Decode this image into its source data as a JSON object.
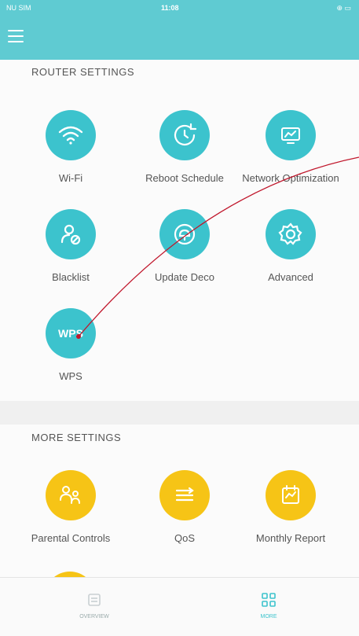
{
  "status_bar": {
    "carrier": "NU SIM",
    "time": "11:08",
    "battery": "⊕ ▭"
  },
  "router_settings": {
    "title": "ROUTER SETTINGS",
    "items": [
      {
        "label": "Wi-Fi",
        "icon": "wifi-icon"
      },
      {
        "label": "Reboot Schedule",
        "icon": "reboot-schedule-icon"
      },
      {
        "label": "Network Optimization",
        "icon": "network-optimization-icon"
      },
      {
        "label": "Blacklist",
        "icon": "blacklist-icon"
      },
      {
        "label": "Update Deco",
        "icon": "update-deco-icon"
      },
      {
        "label": "Advanced",
        "icon": "advanced-gear-icon"
      },
      {
        "label": "WPS",
        "icon": "wps-icon",
        "icon_text": "WPS"
      }
    ]
  },
  "more_settings": {
    "title": "MORE SETTINGS",
    "items": [
      {
        "label": "Parental Controls",
        "icon": "parental-controls-icon"
      },
      {
        "label": "QoS",
        "icon": "qos-icon"
      },
      {
        "label": "Monthly Report",
        "icon": "monthly-report-icon"
      }
    ]
  },
  "tabs": [
    {
      "label": "OVERVIEW",
      "icon": "overview-icon",
      "active": false
    },
    {
      "label": "MORE",
      "icon": "more-grid-icon",
      "active": true
    }
  ],
  "colors": {
    "header": "#5fcbd2",
    "router_icons": "#3cc3cd",
    "more_icons": "#f6c416",
    "annotation": "#c0162b"
  }
}
